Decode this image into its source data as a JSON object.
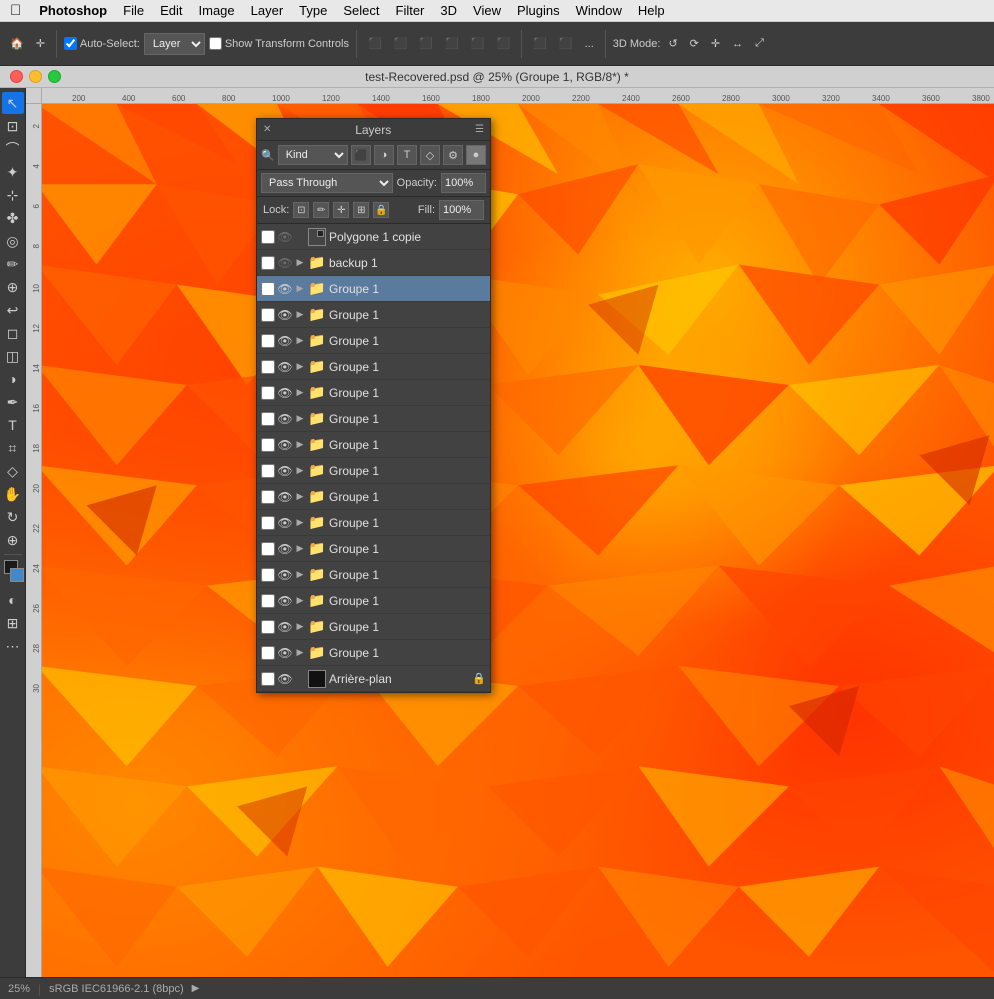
{
  "menubar": {
    "apple": "&#63743;",
    "app_name": "Photoshop",
    "items": [
      "File",
      "Edit",
      "Image",
      "Layer",
      "Type",
      "Select",
      "Filter",
      "3D",
      "View",
      "Plugins",
      "Window",
      "Help"
    ]
  },
  "toolbar": {
    "auto_select_label": "Auto-Select:",
    "auto_select_value": "Layer",
    "show_transform": "Show Transform Controls",
    "mode_label": "3D Mode:",
    "more": "..."
  },
  "title_bar": {
    "title": "test-Recovered.psd @ 25% (Groupe 1, RGB/8*) *"
  },
  "layers_panel": {
    "title": "Layers",
    "filter_label": "Kind",
    "blend_mode": "Pass Through",
    "opacity_label": "Opacity:",
    "opacity_value": "100%",
    "lock_label": "Lock:",
    "fill_label": "Fill:",
    "fill_value": "100%",
    "layers": [
      {
        "name": "Polygone 1 copie",
        "type": "smart",
        "visible": false,
        "active": false
      },
      {
        "name": "backup 1",
        "type": "folder",
        "visible": false,
        "active": false
      },
      {
        "name": "Groupe 1",
        "type": "folder",
        "visible": true,
        "active": true
      },
      {
        "name": "Groupe 1",
        "type": "folder",
        "visible": true,
        "active": false
      },
      {
        "name": "Groupe 1",
        "type": "folder",
        "visible": true,
        "active": false
      },
      {
        "name": "Groupe 1",
        "type": "folder",
        "visible": true,
        "active": false
      },
      {
        "name": "Groupe 1",
        "type": "folder",
        "visible": true,
        "active": false
      },
      {
        "name": "Groupe 1",
        "type": "folder",
        "visible": true,
        "active": false
      },
      {
        "name": "Groupe 1",
        "type": "folder",
        "visible": true,
        "active": false
      },
      {
        "name": "Groupe 1",
        "type": "folder",
        "visible": true,
        "active": false
      },
      {
        "name": "Groupe 1",
        "type": "folder",
        "visible": true,
        "active": false
      },
      {
        "name": "Groupe 1",
        "type": "folder",
        "visible": true,
        "active": false
      },
      {
        "name": "Groupe 1",
        "type": "folder",
        "visible": true,
        "active": false
      },
      {
        "name": "Groupe 1",
        "type": "folder",
        "visible": true,
        "active": false
      },
      {
        "name": "Groupe 1",
        "type": "folder",
        "visible": true,
        "active": false
      },
      {
        "name": "Groupe 1",
        "type": "folder",
        "visible": true,
        "active": false
      },
      {
        "name": "Groupe 1",
        "type": "folder",
        "visible": true,
        "active": false
      },
      {
        "name": "Arrière-plan",
        "type": "background",
        "visible": true,
        "active": false,
        "locked": true
      }
    ]
  },
  "status_bar": {
    "zoom": "25%",
    "profile": "sRGB IEC61966-2.1 (8bpc)"
  },
  "ruler": {
    "h_ticks": [
      "200",
      "400",
      "600",
      "800",
      "1000",
      "1200",
      "1400",
      "1600",
      "1800",
      "2000",
      "2200",
      "2400",
      "2600",
      "2800",
      "3000",
      "3200",
      "3400",
      "3600",
      "3800",
      "400"
    ],
    "v_ticks": [
      "2",
      "4",
      "6",
      "8",
      "10",
      "12",
      "14",
      "16",
      "18",
      "20",
      "22",
      "24",
      "26",
      "28",
      "30"
    ]
  },
  "tools": {
    "items": [
      "↖",
      "⊹",
      "✂",
      "⊡",
      "☍",
      "✏",
      "♦",
      "◻",
      "✒",
      "T",
      "⌗",
      "⊕",
      "🖐",
      "◎",
      "🪣",
      "🎨",
      "◈",
      "3D",
      "⚙"
    ]
  }
}
